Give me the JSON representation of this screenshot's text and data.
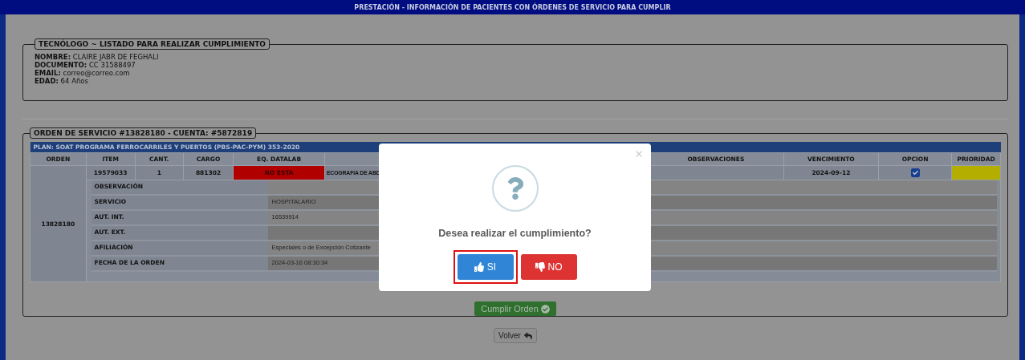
{
  "header": {
    "title": "PRESTACIÓN - INFORMACIÓN DE PACIENTES CON ÓRDENES DE SERVICIO PARA CUMPLIR"
  },
  "technician": {
    "legend": "TECNÓLOGO ~ LISTADO PARA REALIZAR CUMPLIMIENTO",
    "fields": [
      {
        "label": "NOMBRE:",
        "value": "CLAIRE JABR DE FEGHALI"
      },
      {
        "label": "DOCUMENTO:",
        "value": "CC 31588497"
      },
      {
        "label": "EMAIL:",
        "value": "correo@correo.com"
      },
      {
        "label": "EDAD:",
        "value": "64 Años"
      }
    ]
  },
  "order": {
    "legend": "ORDEN DE SERVICIO #13828180 - CUENTA: #5872819",
    "plan": "PLAN: SOAT PROGRAMA FERROCARRILES Y PUERTOS (PBS-PAC-PYM) 353-2020",
    "columns": [
      {
        "label": "ORDEN"
      },
      {
        "label": "ITEM"
      },
      {
        "label": "CANT."
      },
      {
        "label": "CARGO"
      },
      {
        "label": "EQ. DATALAB"
      },
      {},
      {
        "label": "OBSERVACIONES"
      },
      {
        "label": "VENCIMIENTO"
      },
      {
        "label": "OPCION"
      },
      {
        "label": "PRIORIDAD"
      }
    ],
    "row": {
      "orden": "13828180",
      "item": "19579033",
      "cant": "1",
      "cargo": "881302",
      "datalab": "NO ESTA",
      "description": "ECOGRAFIA DE ABD",
      "vencimiento": "2024-09-12",
      "checked": true,
      "color": "#b4ae00"
    },
    "details": [
      {
        "label": "OBSERVACIÓN"
      },
      {
        "label": "SERVICIO",
        "value": "HOSPITALARIO"
      },
      {
        "label": "AUT. INT.",
        "value": "16539914"
      },
      {
        "label": "AUT. EXT."
      },
      {
        "label": "AFILIACIÓN",
        "value": "Especiales o de Excepción Cotizante"
      },
      {
        "label": "FECHA DE LA ORDEN",
        "value": "2024-03-16 08:30:34"
      }
    ],
    "submit": "Cumplir Orden"
  },
  "back": "Volver",
  "modal": {
    "message": "Desea realizar el cumplimiento?",
    "confirm": "SI",
    "cancel": "NO",
    "confirm_focused": true
  }
}
